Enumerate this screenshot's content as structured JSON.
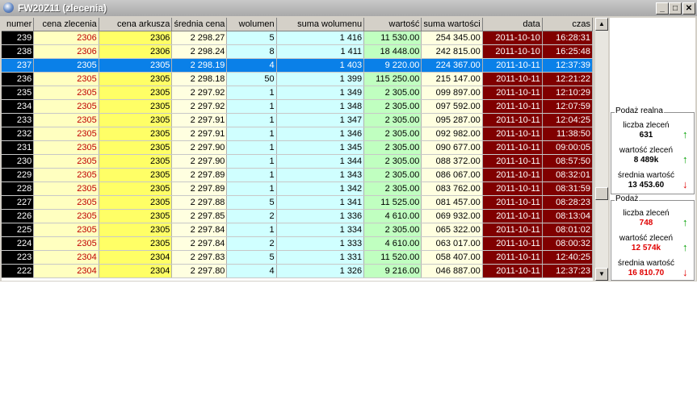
{
  "window": {
    "title": "FW20Z11 (zlecenia)",
    "controls": {
      "minimize": "_",
      "maximize": "□",
      "close": "✕"
    }
  },
  "table": {
    "columns": [
      "numer",
      "cena zlecenia",
      "cena arkusza",
      "średnia cena",
      "wolumen",
      "suma wolumenu",
      "wartość",
      "suma wartości",
      "data",
      "czas"
    ],
    "selected_row": 2,
    "rows": [
      [
        "239",
        "2306",
        "2306",
        "2 298.27",
        "5",
        "1 416",
        "11 530.00",
        "254 345.00",
        "2011-10-10",
        "16:28:31"
      ],
      [
        "238",
        "2306",
        "2306",
        "2 298.24",
        "8",
        "1 411",
        "18 448.00",
        "242 815.00",
        "2011-10-10",
        "16:25:48"
      ],
      [
        "237",
        "2305",
        "2305",
        "2 298.19",
        "4",
        "1 403",
        "9 220.00",
        "224 367.00",
        "2011-10-11",
        "12:37:39"
      ],
      [
        "236",
        "2305",
        "2305",
        "2 298.18",
        "50",
        "1 399",
        "115 250.00",
        "215 147.00",
        "2011-10-11",
        "12:21:22"
      ],
      [
        "235",
        "2305",
        "2305",
        "2 297.92",
        "1",
        "1 349",
        "2 305.00",
        "099 897.00",
        "2011-10-11",
        "12:10:29"
      ],
      [
        "234",
        "2305",
        "2305",
        "2 297.92",
        "1",
        "1 348",
        "2 305.00",
        "097 592.00",
        "2011-10-11",
        "12:07:59"
      ],
      [
        "233",
        "2305",
        "2305",
        "2 297.91",
        "1",
        "1 347",
        "2 305.00",
        "095 287.00",
        "2011-10-11",
        "12:04:25"
      ],
      [
        "232",
        "2305",
        "2305",
        "2 297.91",
        "1",
        "1 346",
        "2 305.00",
        "092 982.00",
        "2011-10-11",
        "11:38:50"
      ],
      [
        "231",
        "2305",
        "2305",
        "2 297.90",
        "1",
        "1 345",
        "2 305.00",
        "090 677.00",
        "2011-10-11",
        "09:00:05"
      ],
      [
        "230",
        "2305",
        "2305",
        "2 297.90",
        "1",
        "1 344",
        "2 305.00",
        "088 372.00",
        "2011-10-11",
        "08:57:50"
      ],
      [
        "229",
        "2305",
        "2305",
        "2 297.89",
        "1",
        "1 343",
        "2 305.00",
        "086 067.00",
        "2011-10-11",
        "08:32:01"
      ],
      [
        "228",
        "2305",
        "2305",
        "2 297.89",
        "1",
        "1 342",
        "2 305.00",
        "083 762.00",
        "2011-10-11",
        "08:31:59"
      ],
      [
        "227",
        "2305",
        "2305",
        "2 297.88",
        "5",
        "1 341",
        "11 525.00",
        "081 457.00",
        "2011-10-11",
        "08:28:23"
      ],
      [
        "226",
        "2305",
        "2305",
        "2 297.85",
        "2",
        "1 336",
        "4 610.00",
        "069 932.00",
        "2011-10-11",
        "08:13:04"
      ],
      [
        "225",
        "2305",
        "2305",
        "2 297.84",
        "1",
        "1 334",
        "2 305.00",
        "065 322.00",
        "2011-10-11",
        "08:01:02"
      ],
      [
        "224",
        "2305",
        "2305",
        "2 297.84",
        "2",
        "1 333",
        "4 610.00",
        "063 017.00",
        "2011-10-11",
        "08:00:32"
      ],
      [
        "223",
        "2304",
        "2304",
        "2 297.83",
        "5",
        "1 331",
        "11 520.00",
        "058 407.00",
        "2011-10-11",
        "12:40:25"
      ],
      [
        "222",
        "2304",
        "2304",
        "2 297.80",
        "4",
        "1 326",
        "9 216.00",
        "046 887.00",
        "2011-10-11",
        "12:37:23"
      ]
    ]
  },
  "scrollbar": {
    "up": "▲",
    "down": "▼"
  },
  "panel": {
    "real": {
      "title": "Podaż realna",
      "count_label": "liczba zleceń",
      "count_value": "631",
      "count_trend": "↑",
      "value_label": "wartość zleceń",
      "value_value": "8 489k",
      "value_trend": "↑",
      "avg_label": "średnia wartość",
      "avg_value": "13 453.60",
      "avg_trend": "↓"
    },
    "supply": {
      "title": "Podaż",
      "count_label": "liczba zleceń",
      "count_value": "748",
      "count_trend": "↑",
      "value_label": "wartość zleceń",
      "value_value": "12 574k",
      "value_trend": "↑",
      "avg_label": "średnia wartość",
      "avg_value": "16 810.70",
      "avg_trend": "↓"
    }
  },
  "colors": {
    "selection": "#0a80e8",
    "date_bg": "#800000",
    "trend_up": "#00a000",
    "trend_down": "#e00000"
  }
}
